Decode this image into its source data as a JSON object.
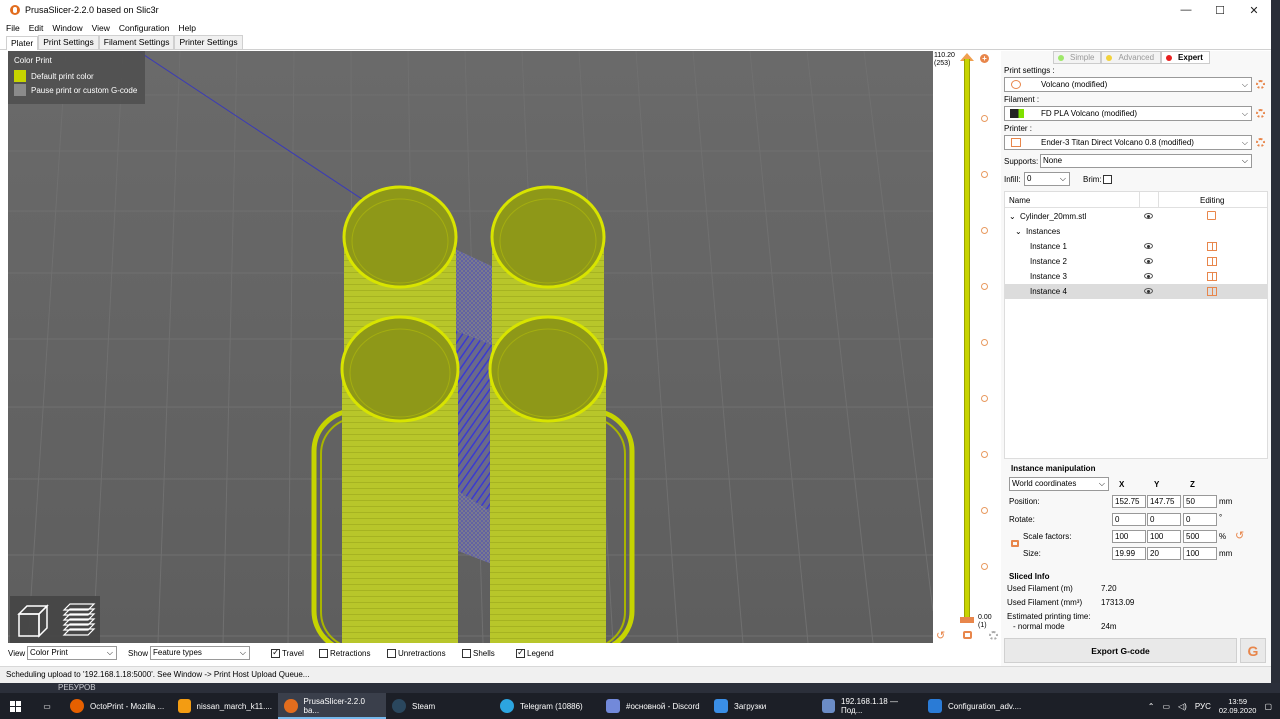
{
  "window": {
    "title": "PrusaSlicer-2.2.0 based on Slic3r",
    "controls": [
      "—",
      "☐",
      "✕"
    ]
  },
  "menu": [
    "File",
    "Edit",
    "Window",
    "View",
    "Configuration",
    "Help"
  ],
  "tabs": [
    "Plater",
    "Print Settings",
    "Filament Settings",
    "Printer Settings"
  ],
  "legend": {
    "title": "Color Print",
    "items": [
      {
        "label": "Default print color",
        "color": "#c6d400"
      },
      {
        "label": "Pause print or custom G-code",
        "color": "#8a8a8a"
      }
    ]
  },
  "slider": {
    "top_value": "110.20",
    "top_layer": "(253)",
    "bottom_value": "0.00",
    "bottom_layer": "(1)"
  },
  "modes": {
    "simple": "Simple",
    "advanced": "Advanced",
    "expert": "Expert",
    "colors": {
      "simple": "#9ee86a",
      "advanced": "#f2d23c",
      "expert": "#e82020"
    }
  },
  "settings": {
    "print_label": "Print settings :",
    "print_value": "Volcano (modified)",
    "filament_label": "Filament :",
    "filament_value": "FD PLA  Volcano (modified)",
    "printer_label": "Printer :",
    "printer_value": "Ender-3 Titan Direct Volcano 0.8 (modified)",
    "supports_label": "Supports:",
    "supports_value": "None",
    "infill_label": "Infill:",
    "infill_value": "0",
    "brim_label": "Brim:"
  },
  "object_list": {
    "col_name": "Name",
    "col_editing": "Editing",
    "object": "Cylinder_20mm.stl",
    "instances_label": "Instances",
    "instances": [
      "Instance 1",
      "Instance 2",
      "Instance 3",
      "Instance 4"
    ]
  },
  "manipulation": {
    "title": "Instance manipulation",
    "coord_system": "World coordinates",
    "x": "X",
    "y": "Y",
    "z": "Z",
    "position_label": "Position:",
    "position": [
      "152.75",
      "147.75",
      "50"
    ],
    "position_unit": "mm",
    "rotate_label": "Rotate:",
    "rotate": [
      "0",
      "0",
      "0"
    ],
    "rotate_unit": "°",
    "scale_label": "Scale factors:",
    "scale": [
      "100",
      "100",
      "500"
    ],
    "scale_unit": "%",
    "size_label": "Size:",
    "size": [
      "19.99",
      "20",
      "100"
    ],
    "size_unit": "mm"
  },
  "sliced_info": {
    "title": "Sliced Info",
    "used_m_label": "Used Filament (m)",
    "used_m": "7.20",
    "used_mm3_label": "Used Filament (mm³)",
    "used_mm3": "17313.09",
    "est_label": "Estimated printing time:",
    "normal_label": "- normal mode",
    "normal_value": "24m"
  },
  "export_label": "Export G-code",
  "bottom": {
    "view_label": "View",
    "view_value": "Color Print",
    "show_label": "Show",
    "show_value": "Feature types",
    "checks": [
      {
        "label": "Travel",
        "checked": true
      },
      {
        "label": "Retractions",
        "checked": false
      },
      {
        "label": "Unretractions",
        "checked": false
      },
      {
        "label": "Shells",
        "checked": false
      },
      {
        "label": "Legend",
        "checked": true
      }
    ]
  },
  "status": "Scheduling upload to '192.168.1.18:5000'. See Window -> Print Host Upload Queue...",
  "behind_text": "PEБУРОВ",
  "taskbar": {
    "apps": [
      {
        "label": "OctoPrint - Mozilla ...",
        "color": "#e66000"
      },
      {
        "label": "nissan_march_k11....",
        "color": "#f39c12"
      },
      {
        "label": "PrusaSlicer-2.2.0 ba...",
        "color": "#e26d1e"
      },
      {
        "label": "Steam",
        "color": "#1b2838"
      },
      {
        "label": "Telegram (10886)",
        "color": "#2ca5e0"
      },
      {
        "label": "#основной - Discord",
        "color": "#7289da"
      },
      {
        "label": "Загрузки",
        "color": "#3a8ee6"
      },
      {
        "label": "192.168.1.18 — Под...",
        "color": "#6b8cc6"
      },
      {
        "label": "Configuration_adv....",
        "color": "#2a7bd6"
      }
    ],
    "lang": "РУС",
    "time": "13:59",
    "date": "02.09.2020"
  }
}
